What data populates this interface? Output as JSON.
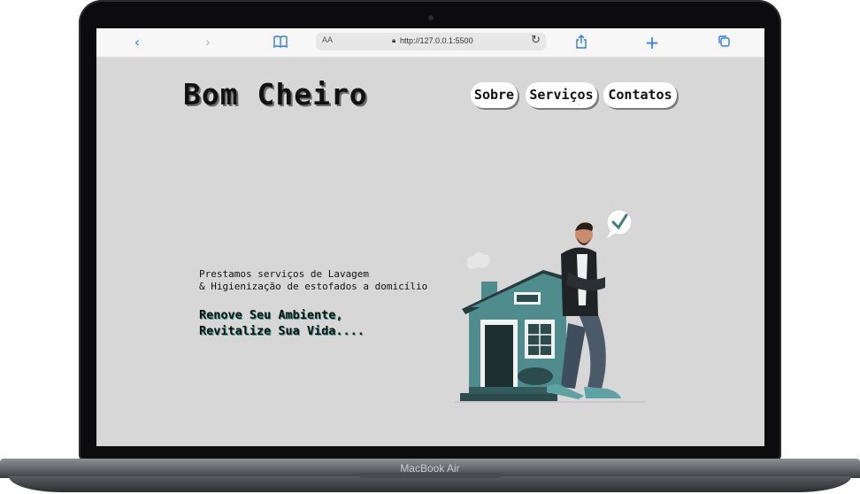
{
  "browser": {
    "url": "http://127.0.0.1:5500",
    "reader_label": "AA",
    "icons": [
      "back-icon",
      "forward-icon",
      "bookmarks-icon",
      "lock-icon",
      "reload-icon",
      "share-icon",
      "new-tab-icon",
      "tabs-icon"
    ]
  },
  "site": {
    "brand": "Bom Cheiro",
    "nav": [
      "Sobre",
      "Serviços",
      "Contatos"
    ],
    "tagline_line1": "Prestamos serviços de Lavagem",
    "tagline_line2": "& Higienização de estofados a domicílio",
    "slogan_line1": "Renove Seu Ambiente,",
    "slogan_line2": "Revitalize Sua Vida....",
    "colors": {
      "page_bg": "#d7d7d7",
      "accent": "#3f7f80",
      "text": "#111111"
    }
  },
  "device": {
    "label": "MacBook Air"
  }
}
